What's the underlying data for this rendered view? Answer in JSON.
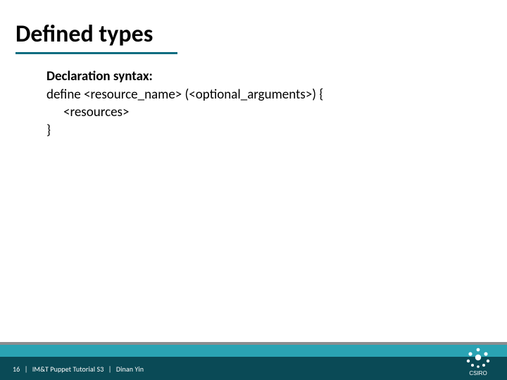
{
  "title": "Defined types",
  "body": {
    "heading": "Declaration syntax:",
    "line1": "define <resource_name> (<optional_arguments>) {",
    "line2": "<resources>",
    "line3": "}"
  },
  "footer": {
    "page": "16",
    "doc": "IM&T Puppet Tutorial S3",
    "author": "Dinan Yin"
  },
  "logo_label": "CSIRO"
}
